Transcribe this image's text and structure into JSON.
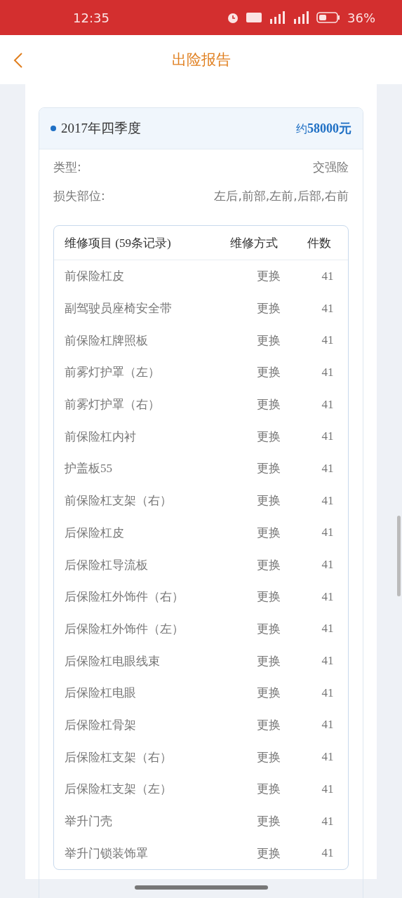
{
  "status_bar": {
    "time": "12:35",
    "battery": "36%"
  },
  "header": {
    "title": "出险报告"
  },
  "record": {
    "period": "2017年四季度",
    "amount_prefix": "约",
    "amount": "58000元",
    "fields": [
      {
        "label": "类型:",
        "value": "交强险"
      },
      {
        "label": "损失部位:",
        "value": "左后,前部,左前,后部,右前"
      }
    ],
    "table": {
      "columns": [
        {
          "title": "维修项目",
          "note": "(59条记录)"
        },
        {
          "title": "维修方式"
        },
        {
          "title": "件数"
        }
      ],
      "rows": [
        [
          "前保险杠皮",
          "更换",
          "41"
        ],
        [
          "副驾驶员座椅安全带",
          "更换",
          "41"
        ],
        [
          "前保险杠牌照板",
          "更换",
          "41"
        ],
        [
          "前雾灯护罩（左）",
          "更换",
          "41"
        ],
        [
          "前雾灯护罩（右）",
          "更换",
          "41"
        ],
        [
          "前保险杠内衬",
          "更换",
          "41"
        ],
        [
          "护盖板55",
          "更换",
          "41"
        ],
        [
          "前保险杠支架（右）",
          "更换",
          "41"
        ],
        [
          "后保险杠皮",
          "更换",
          "41"
        ],
        [
          "后保险杠导流板",
          "更换",
          "41"
        ],
        [
          "后保险杠外饰件（右）",
          "更换",
          "41"
        ],
        [
          "后保险杠外饰件（左）",
          "更换",
          "41"
        ],
        [
          "后保险杠电眼线束",
          "更换",
          "41"
        ],
        [
          "后保险杠电眼",
          "更换",
          "41"
        ],
        [
          "后保险杠骨架",
          "更换",
          "41"
        ],
        [
          "后保险杠支架（右）",
          "更换",
          "41"
        ],
        [
          "后保险杠支架（左）",
          "更换",
          "41"
        ],
        [
          "举升门壳",
          "更换",
          "41"
        ],
        [
          "举升门锁装饰罩",
          "更换",
          "41"
        ]
      ]
    }
  }
}
